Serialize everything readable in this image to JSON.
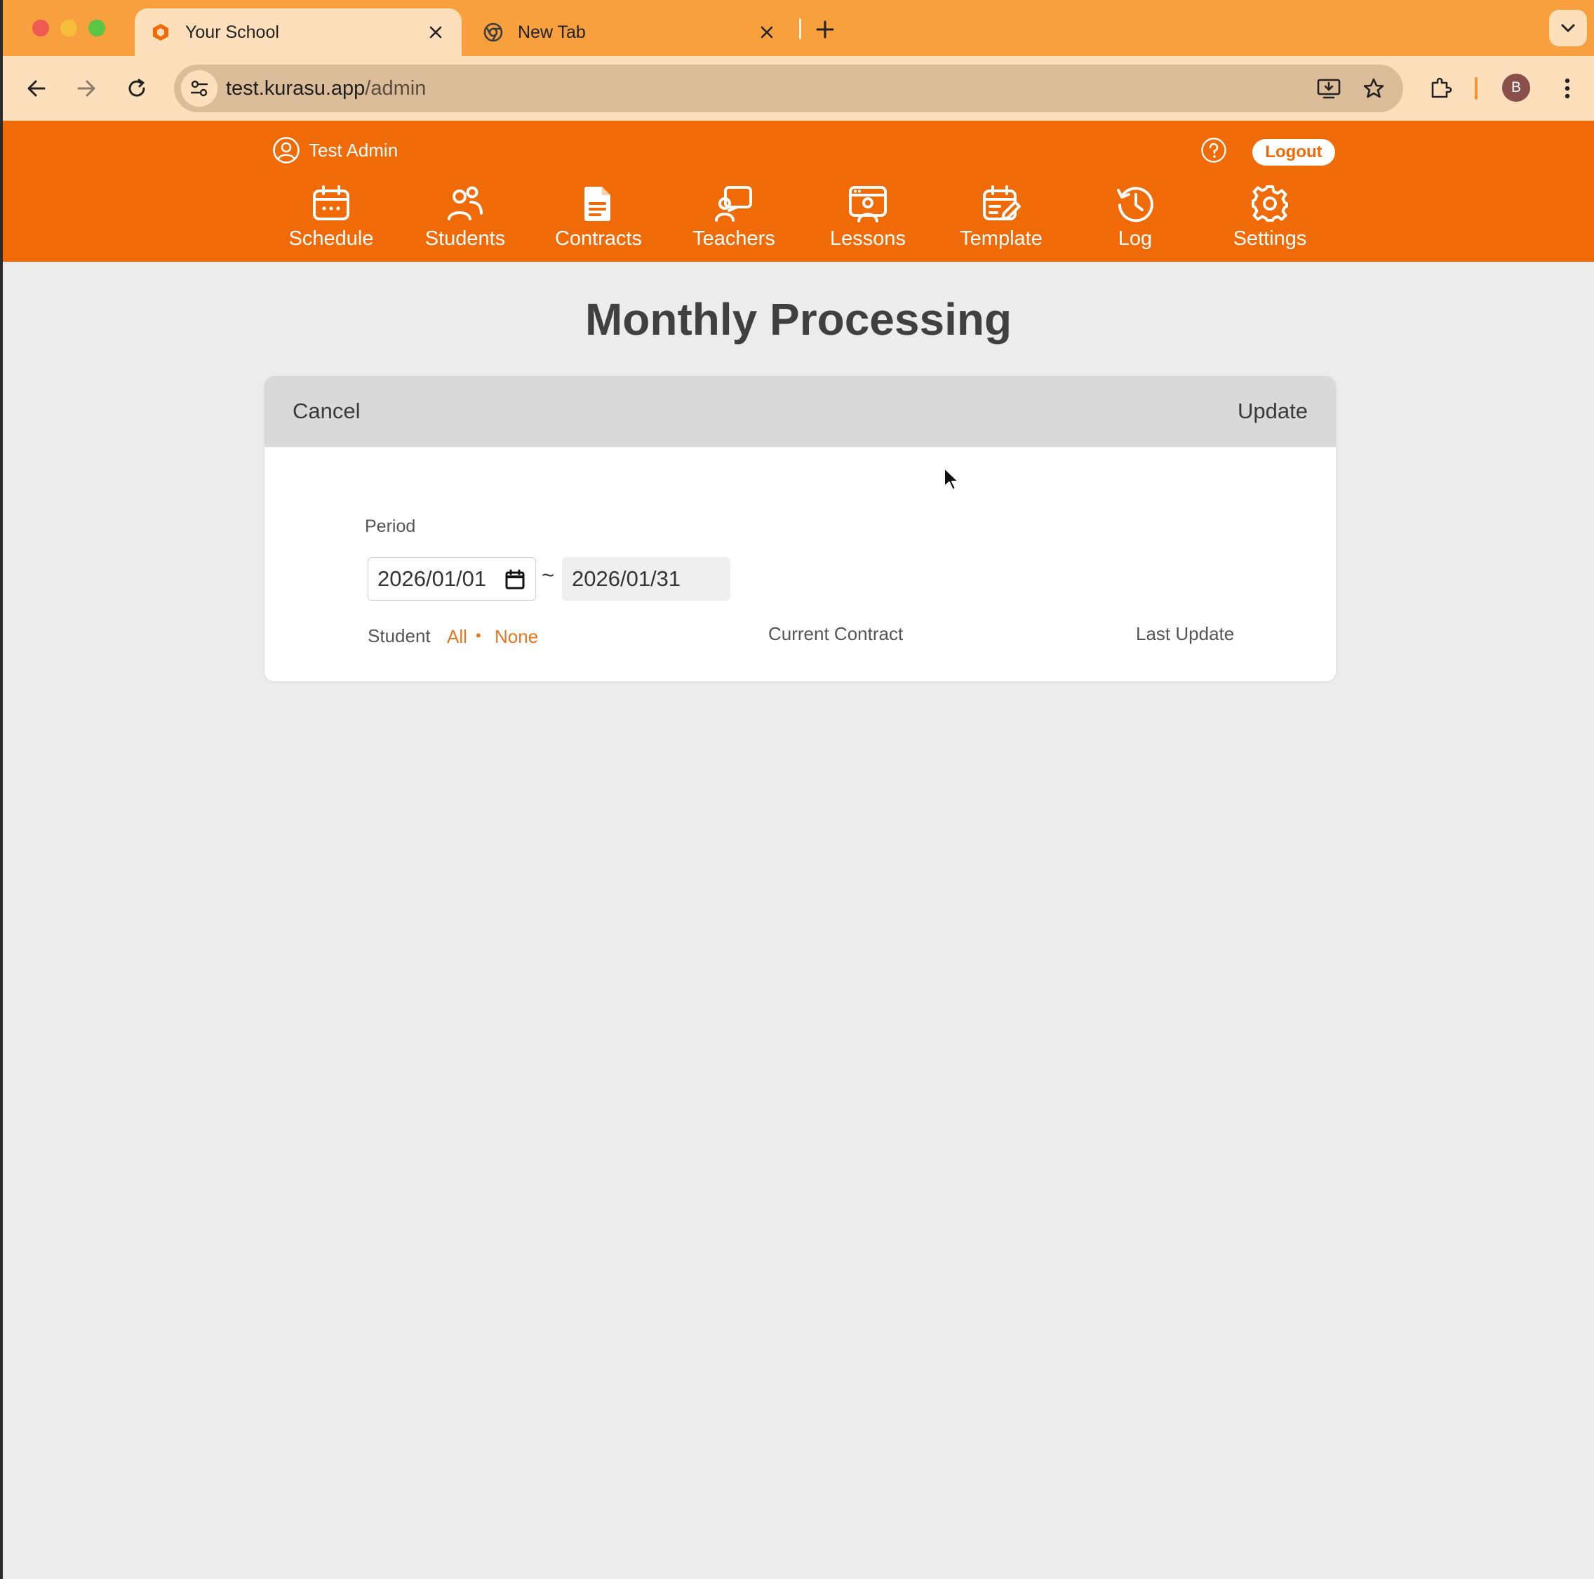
{
  "browser": {
    "tabs": [
      {
        "title": "Your School",
        "active": true,
        "favicon": "school-shield-icon"
      },
      {
        "title": "New Tab",
        "active": false,
        "favicon": "chrome-icon"
      }
    ],
    "url": {
      "host": "test.kurasu.app",
      "path": "/admin"
    },
    "profile_initial": "B"
  },
  "colors": {
    "brand": "#f06b07",
    "tabstrip": "#f8a03e",
    "toolbar": "#fde0bb",
    "link": "#e47722"
  },
  "app": {
    "user_name": "Test Admin",
    "logout_label": "Logout",
    "nav": [
      {
        "label": "Schedule",
        "icon": "calendar-icon"
      },
      {
        "label": "Students",
        "icon": "students-icon"
      },
      {
        "label": "Contracts",
        "icon": "document-icon"
      },
      {
        "label": "Teachers",
        "icon": "teacher-icon"
      },
      {
        "label": "Lessons",
        "icon": "lessons-icon"
      },
      {
        "label": "Template",
        "icon": "template-icon"
      },
      {
        "label": "Log",
        "icon": "history-icon"
      },
      {
        "label": "Settings",
        "icon": "gear-icon"
      }
    ]
  },
  "page": {
    "title": "Monthly Processing",
    "cancel_label": "Cancel",
    "update_label": "Update",
    "period_label": "Period",
    "start_date": "2026/01/01",
    "separator": "~",
    "end_date": "2026/01/31",
    "student_label": "Student",
    "select_all": "All",
    "select_sep": "•",
    "select_none": "None",
    "current_contract_label": "Current Contract",
    "last_update_label": "Last Update"
  }
}
